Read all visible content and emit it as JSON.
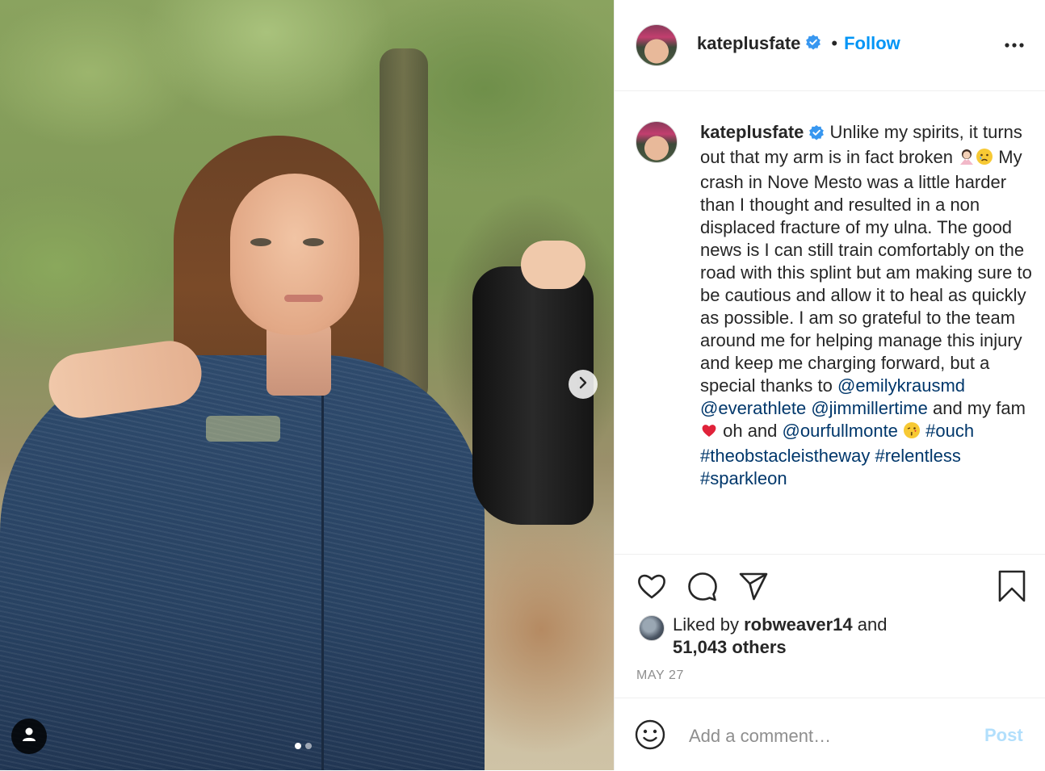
{
  "post": {
    "username": "kateplusfate",
    "follow_label": "Follow",
    "separator": "•",
    "caption": {
      "text1": " Unlike my spirits, it turns out that my arm is in fact broken ",
      "text2": " My crash in Nove Mesto was a little harder than I thought and resulted in a non displaced fracture of my ulna. The good news is I can still train comfortably on the road with this splint but am making sure to be cautious and allow it to heal as quickly as possible. I am so grateful to the team around me for helping manage this injury and keep me charging forward, but a special thanks to ",
      "mention1": "@emilykrausmd",
      "mention2": "@everathlete",
      "mention3": "@jimmillertime",
      "text3": " and my fam ",
      "text4": " oh and ",
      "mention4": "@ourfullmonte",
      "hashtag1": "#ouch",
      "hashtag2": "#theobstacleistheway",
      "hashtag3": "#relentless",
      "hashtag4": "#sparkleon"
    },
    "likes": {
      "prefix": "Liked by",
      "liker": "robweaver14",
      "and": "and",
      "count": "51,043 others"
    },
    "date": "MAY 27",
    "comment_placeholder": "Add a comment…",
    "post_label": "Post",
    "carousel": {
      "current": 1,
      "total": 2
    }
  },
  "icons": {
    "verified": "verified-badge-icon",
    "more": "more-options-icon",
    "like": "heart-icon",
    "comment": "comment-icon",
    "share": "paper-plane-icon",
    "save": "bookmark-icon",
    "emoji": "emoji-icon",
    "next": "chevron-right-icon",
    "tag": "user-tag-icon"
  },
  "colors": {
    "link": "#00376b",
    "follow": "#0095f6",
    "post_disabled": "#b2dffc",
    "muted": "#8e8e8e",
    "text": "#262626"
  }
}
